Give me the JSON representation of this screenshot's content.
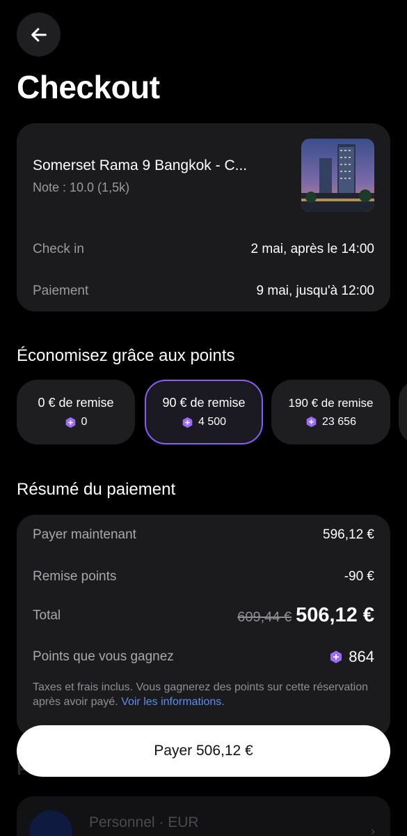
{
  "header": {
    "title": "Checkout"
  },
  "icons": {
    "back": "arrow-left-icon",
    "points": "points-gem-icon",
    "chevron": "chevron-right-icon"
  },
  "colors": {
    "accent": "#8b5cf6",
    "link": "#5b8def",
    "background": "#000000",
    "card": "#1b1b1e"
  },
  "hotel": {
    "name": "Somerset Rama 9 Bangkok - C...",
    "rating": "Note : 10.0 (1,5k)",
    "checkin_label": "Check in",
    "checkin_value": "2 mai, après le 14:00",
    "payment_label": "Paiement",
    "payment_value": "9 mai, jusqu'à 12:00"
  },
  "points_section": {
    "title": "Économisez grâce aux points",
    "options": [
      {
        "label": "0 € de remise",
        "points": "0",
        "selected": false
      },
      {
        "label": "90 € de remise",
        "points": "4 500",
        "selected": true
      },
      {
        "label": "190 € de remise",
        "points": "23 656",
        "selected": false
      }
    ]
  },
  "summary": {
    "title": "Résumé du paiement",
    "pay_now_label": "Payer maintenant",
    "pay_now_value": "596,12 €",
    "discount_label": "Remise points",
    "discount_value": "-90 €",
    "total_label": "Total",
    "total_old": "609,44 €",
    "total_new": "506,12 €",
    "earn_label": "Points que vous gagnez",
    "earn_value": "864",
    "note": "Taxes et frais inclus. Vous gagnerez des points sur cette réservation après avoir payé.",
    "note_link": "Voir les informations."
  },
  "payment_method": {
    "title": "Pa",
    "account": "Personnel · EUR"
  },
  "cta": {
    "label": "Payer 506,12 €"
  }
}
